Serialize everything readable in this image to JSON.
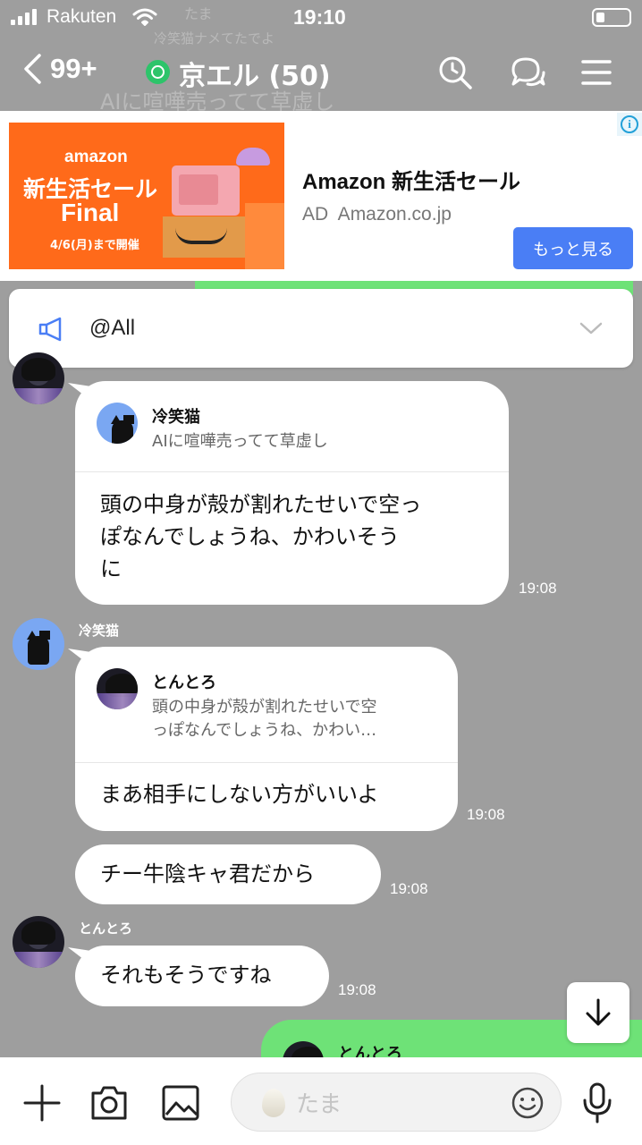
{
  "status_bar": {
    "carrier": "Rakuten",
    "time": "19:10",
    "battery_level": 0.2
  },
  "header": {
    "back_count": "99+",
    "title": "京エル (50)",
    "icons": [
      "back-chevron-icon",
      "group-icon",
      "search-icon",
      "chat-bubbles-icon",
      "menu-icon"
    ]
  },
  "background_texts": {
    "name": "たま",
    "blurred": "冷笑猫ナメてたでよ",
    "quote": "AIに喧嘩売ってて草虚し"
  },
  "ad": {
    "image": {
      "brand": "amazon",
      "line1": "新生活セール",
      "line2": "Final",
      "date": "4/6(月)まで開催"
    },
    "title": "Amazon 新生活セール",
    "sub": "AD  Amazon.co.jp",
    "button": "もっと見る",
    "info_glyph": "i"
  },
  "announcement": {
    "text": "@All",
    "icon": "megaphone-icon",
    "chevron": "chevron-down-icon"
  },
  "messages": [
    {
      "sender": "",
      "reply_name": "冷笑猫",
      "reply_text": "AIに喧嘩売ってて草虚し",
      "text_lines": [
        "頭の中身が殻が割れたせいで空っ",
        "ぽなんでしょうね、かわいそう",
        "に"
      ],
      "time": "19:08"
    },
    {
      "sender": "冷笑猫",
      "reply_name": "とんとろ",
      "reply_text_lines": [
        "頭の中身が殻が割れたせいで空",
        "っぽなんでしょうね、かわい…"
      ],
      "text": "まあ相手にしない方がいいよ",
      "time": "19:08"
    },
    {
      "text": "チー牛陰キャ君だから",
      "time": "19:08"
    },
    {
      "sender": "とんとろ",
      "text": "それもそうですね",
      "time": "19:08"
    },
    {
      "own": true,
      "reply_name": "とんとろ"
    }
  ],
  "input": {
    "placeholder": "たま"
  },
  "colors": {
    "chat_bg": "#9e9e9e",
    "own_bubble": "#6ee277",
    "ad_button": "#4a7ef5",
    "group_badge": "#2dc46a"
  }
}
